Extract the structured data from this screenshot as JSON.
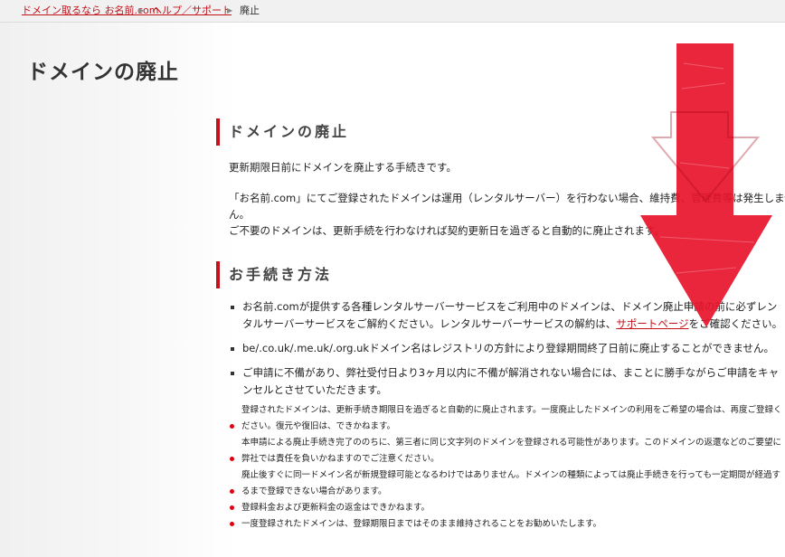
{
  "breadcrumb": {
    "items": [
      {
        "label": "ドメイン取るなら お名前.com",
        "link": true
      },
      {
        "label": "ヘルプ／サポート",
        "link": true
      },
      {
        "label": "廃止",
        "link": false
      }
    ]
  },
  "page_title": "ドメインの廃止",
  "section1": {
    "heading": "ドメインの廃止",
    "intro": "更新期限日前にドメインを廃止する手続きです。",
    "para1_line1": "「お名前.com」にてご登録されたドメインは運用（レンタルサーバー）を行わない場合、維持費、管理費等は発生しませ",
    "para1_line2": "ん。",
    "para2": "ご不要のドメインは、更新手続を行わなければ契約更新日を過ぎると自動的に廃止されます。"
  },
  "section2": {
    "heading": "お手続き方法",
    "bullet1_before": "お名前.comが提供する各種レンタルサーバーサービスをご利用中のドメインは、ドメイン廃止申請の前に必ずレンタルサーバーサービスをご解約ください。レンタルサーバーサービスの解約は、",
    "bullet1_link": "サポートページ",
    "bullet1_after": "をご確認ください。",
    "bullet2": "be/.co.uk/.me.uk/.org.ukドメイン名はレジストリの方針により登録期間終了日前に廃止することができません。",
    "bullet3": "ご申請に不備があり、弊社受付日より3ヶ月以内に不備が解消されない場合には、まことに勝手ながらご申請をキャンセルとさせていただきます。"
  },
  "notes": [
    "登録されたドメインは、更新手続き期限日を過ぎると自動的に廃止されます。一度廃止したドメインの利用をご希望の場合は、再度ご登録ください。復元や復旧は、できかねます。",
    "本申請による廃止手続き完了ののちに、第三者に同じ文字列のドメインを登録される可能性があります。このドメインの返還などのご要望に弊社では責任を負いかねますのでご注意ください。",
    "廃止後すぐに同一ドメイン名が新規登録可能となるわけではありません。ドメインの種類によっては廃止手続きを行っても一定期間が経過するまで登録できない場合があります。",
    "登録料金および更新料金の返金はできかねます。",
    "一度登録されたドメインは、登録期限日まではそのまま維持されることをお勧めいたします。"
  ],
  "colors": {
    "accent": "#c4121b",
    "arrow": "#e8132b",
    "note_dot": "#e00012"
  }
}
